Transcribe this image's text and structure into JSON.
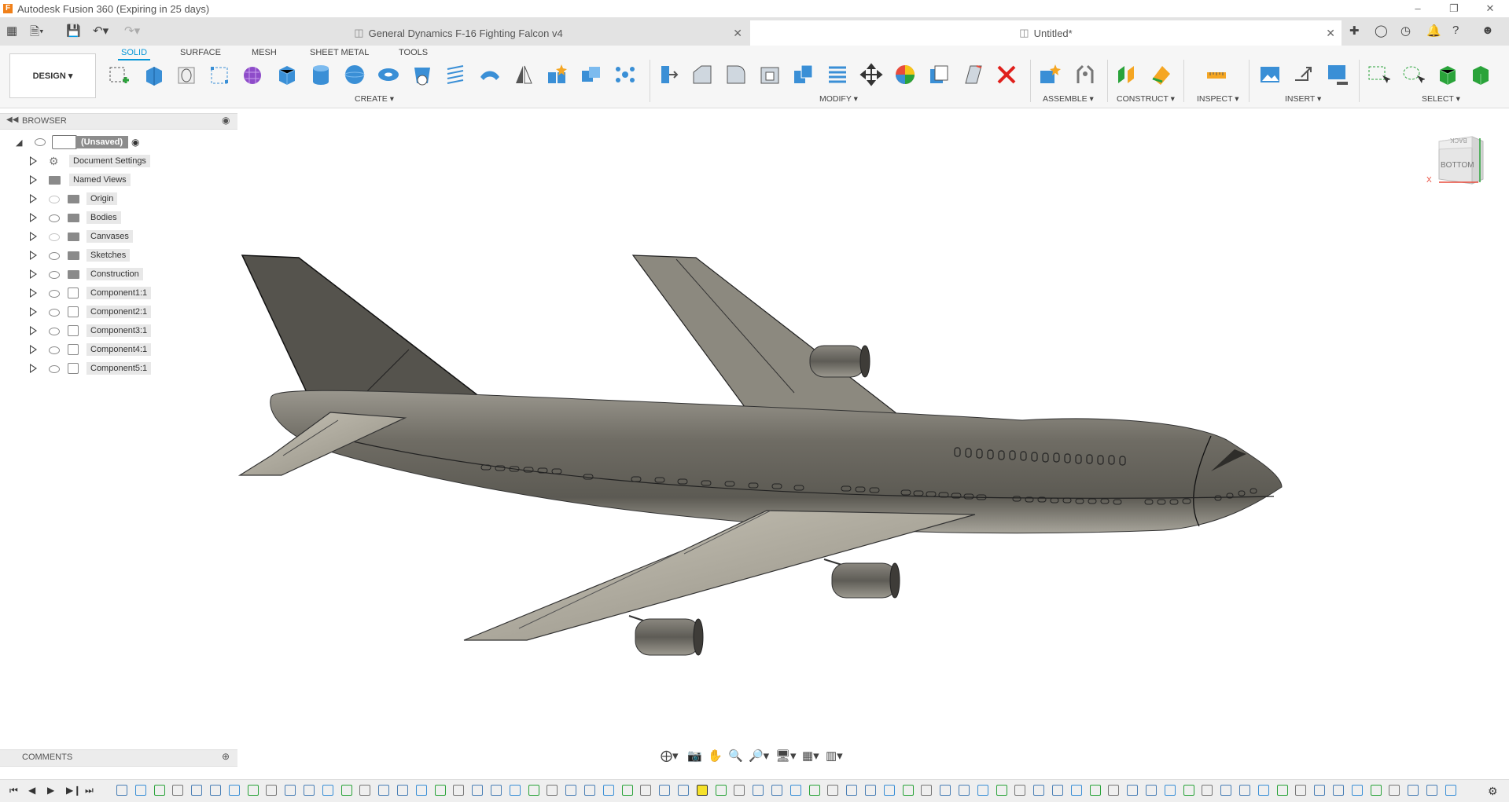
{
  "app": {
    "title": "Autodesk Fusion 360 (Expiring in 25 days)",
    "logo_letter": "F"
  },
  "tabs": [
    {
      "label": "General Dynamics F-16 Fighting Falcon v4",
      "active": false
    },
    {
      "label": "Untitled*",
      "active": true
    }
  ],
  "ribbon": {
    "workspace": "DESIGN",
    "tabs": [
      "SOLID",
      "SURFACE",
      "MESH",
      "SHEET METAL",
      "TOOLS"
    ],
    "active_tab": "SOLID",
    "groups": [
      "CREATE",
      "MODIFY",
      "ASSEMBLE",
      "CONSTRUCT",
      "INSPECT",
      "INSERT",
      "SELECT"
    ]
  },
  "browser": {
    "header": "BROWSER",
    "root": "(Unsaved)",
    "items": [
      {
        "label": "Document Settings",
        "icon": "gear-icon"
      },
      {
        "label": "Named Views",
        "icon": "folder-icon"
      },
      {
        "label": "Origin",
        "icon": "folder-icon"
      },
      {
        "label": "Bodies",
        "icon": "folder-icon"
      },
      {
        "label": "Canvases",
        "icon": "folder-icon"
      },
      {
        "label": "Sketches",
        "icon": "folder-icon"
      },
      {
        "label": "Construction",
        "icon": "folder-icon"
      },
      {
        "label": "Component1:1",
        "icon": "component-icon"
      },
      {
        "label": "Component2:1",
        "icon": "component-icon"
      },
      {
        "label": "Component3:1",
        "icon": "component-icon"
      },
      {
        "label": "Component4:1",
        "icon": "component-icon"
      },
      {
        "label": "Component5:1",
        "icon": "component-icon"
      }
    ]
  },
  "comments": {
    "label": "COMMENTS"
  },
  "viewcube": {
    "face": "BOTTOM",
    "back_face": "BACK",
    "axis": "X"
  },
  "colors": {
    "accent": "#0696d7",
    "tool_blue": "#3a8fd6",
    "aircraft": "#6e6b63"
  }
}
